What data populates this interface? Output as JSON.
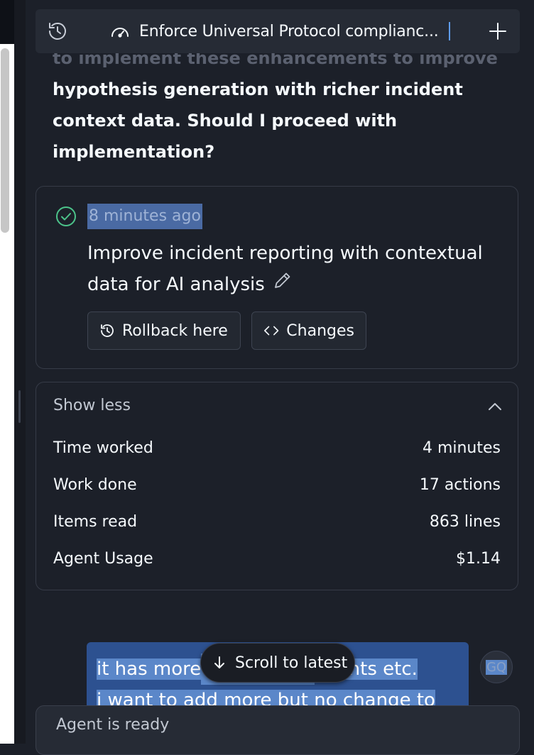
{
  "header": {
    "title": "Enforce Universal Protocol complianc..."
  },
  "message": {
    "faded_line": "to implement these enhancements to improve AI",
    "text": "hypothesis generation with richer incident context data. Should I proceed with implementation?"
  },
  "checkpoint": {
    "timestamp": "8 minutes ago",
    "description": "Improve incident reporting with contextual data for AI analysis",
    "rollback_label": "Rollback here",
    "changes_label": "Changes"
  },
  "stats": {
    "toggle_label": "Show less",
    "rows": [
      {
        "label": "Time worked",
        "value": "4 minutes"
      },
      {
        "label": "Work done",
        "value": "17 actions"
      },
      {
        "label": "Items read",
        "value": "863 lines"
      },
      {
        "label": "Agent Usage",
        "value": "$1.14"
      }
    ]
  },
  "user_message": {
    "line1": "it has more",
    "line1_end": "events etc.",
    "line2": "i want to add more but no change to",
    "avatar_initials": "GQ"
  },
  "scroll_latest_label": "Scroll to latest",
  "agent_status": "Agent is ready",
  "icons": {
    "history": "history-icon",
    "gauge": "gauge-icon",
    "plus": "plus-icon",
    "check": "check-circle-icon",
    "pencil": "pencil-icon",
    "rollback": "rollback-icon",
    "code": "code-icon",
    "chevron": "chevron-up-icon",
    "arrow": "arrow-down-icon"
  },
  "colors": {
    "background": "#1c2029",
    "accent": "#5e9cf0",
    "success": "#4cc38a",
    "selection": "#5b87c9"
  }
}
